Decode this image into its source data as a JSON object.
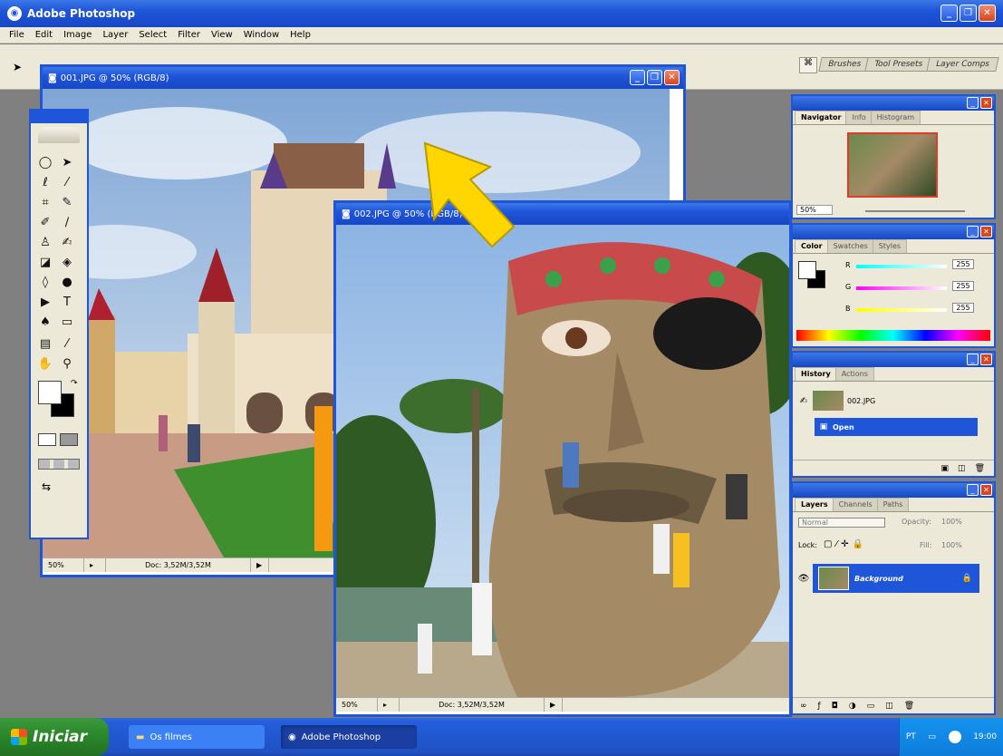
{
  "app": {
    "title": "Adobe Photoshop",
    "menu": [
      "File",
      "Edit",
      "Image",
      "Layer",
      "Select",
      "Filter",
      "View",
      "Window",
      "Help"
    ],
    "workspace_tabs": [
      "Brushes",
      "Tool Presets",
      "Layer Comps"
    ]
  },
  "doc1": {
    "title": "001.JPG @ 50% (RGB/8)",
    "zoom": "50%",
    "doc_size": "Doc: 3,52M/3,52M"
  },
  "doc2": {
    "title": "002.JPG @ 50% (RGB/8)",
    "zoom": "50%",
    "doc_size": "Doc: 3,52M/3,52M"
  },
  "navigator": {
    "tabs": [
      "Navigator",
      "Info",
      "Histogram"
    ],
    "zoom": "50%"
  },
  "color": {
    "tabs": [
      "Color",
      "Swatches",
      "Styles"
    ],
    "channels": [
      {
        "label": "R",
        "value": "255"
      },
      {
        "label": "G",
        "value": "255"
      },
      {
        "label": "B",
        "value": "255"
      }
    ]
  },
  "history": {
    "tabs": [
      "History",
      "Actions"
    ],
    "items": [
      "002.JPG",
      "Open"
    ]
  },
  "layers": {
    "tabs": [
      "Layers",
      "Channels",
      "Paths"
    ],
    "blend_mode": "Normal",
    "opacity_label": "Opacity:",
    "opacity": "100%",
    "lock_label": "Lock:",
    "fill_label": "Fill:",
    "fill": "100%",
    "layer_name": "Background"
  },
  "taskbar": {
    "start": "Iniciar",
    "tasks": [
      "Os filmes",
      "Adobe Photoshop"
    ],
    "tray_lang": "PT",
    "clock": "19:00"
  },
  "colors": {
    "xp_blue": "#1f55d9",
    "chrome": "#ece9d8",
    "arrow": "#ffd600"
  }
}
